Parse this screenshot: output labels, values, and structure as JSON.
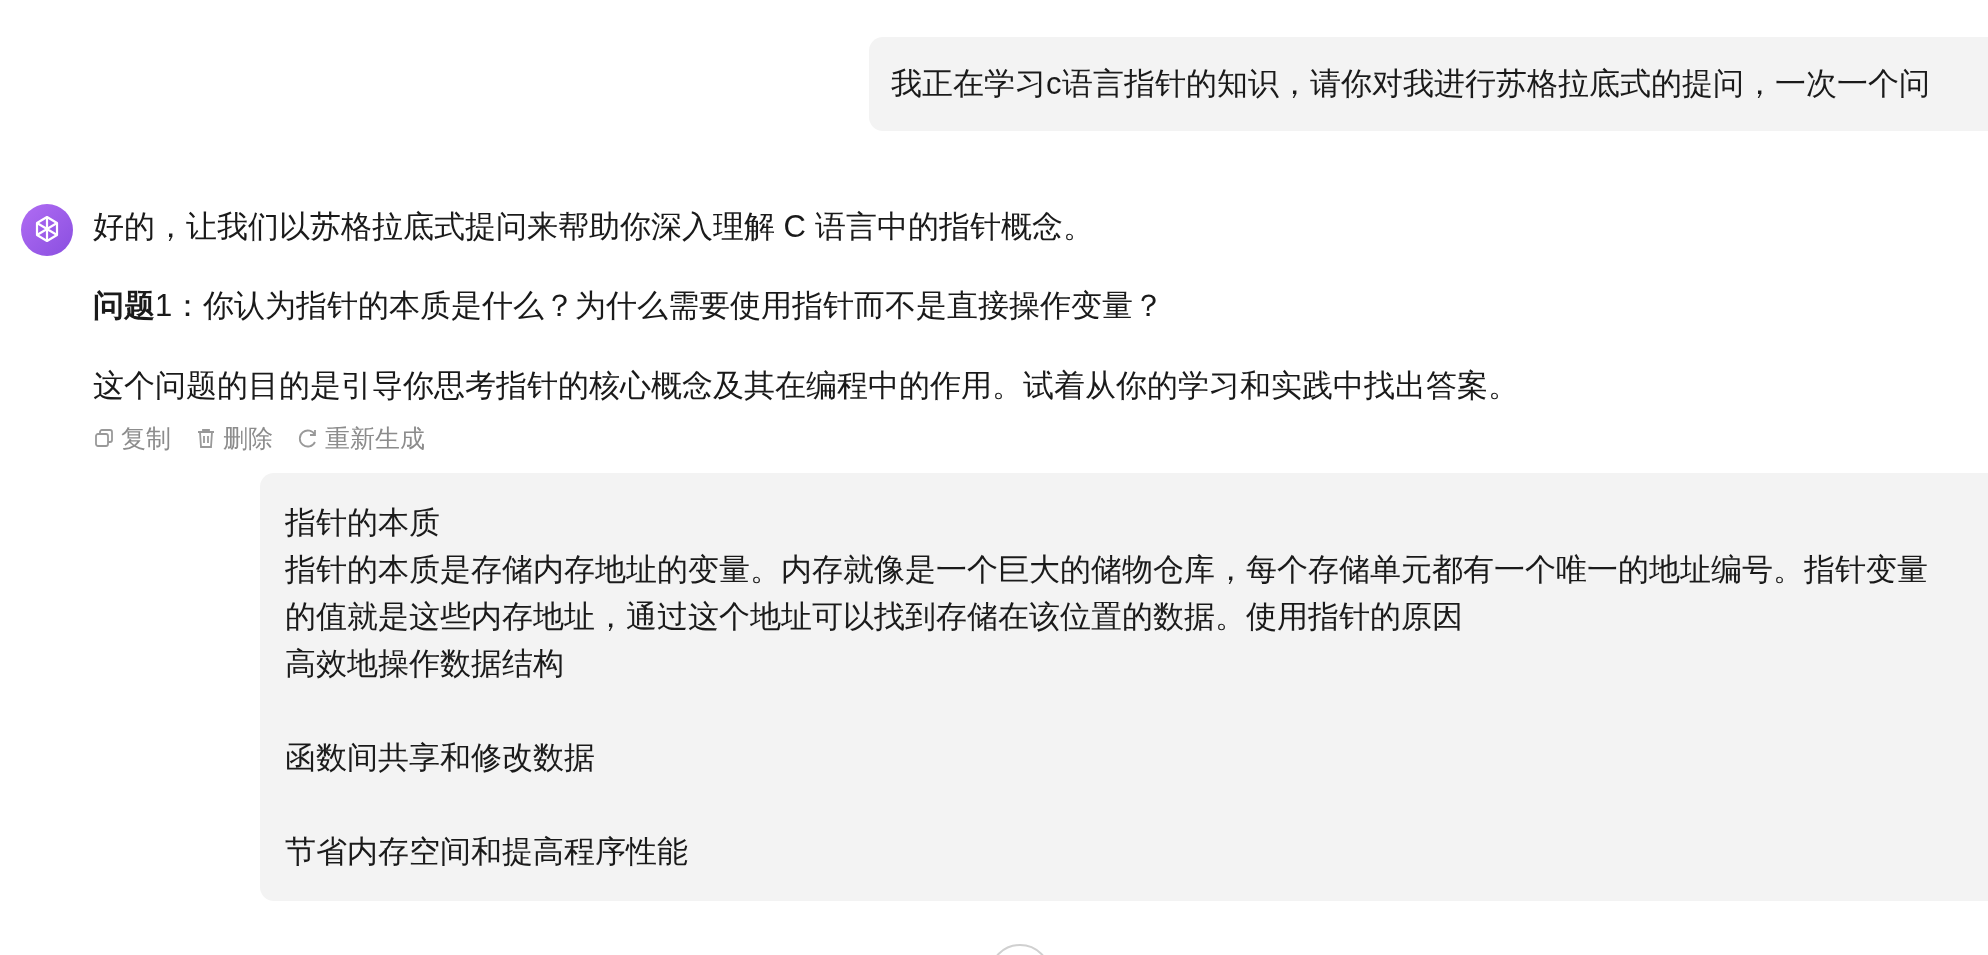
{
  "user_message": {
    "text": "我正在学习c语言指针的知识，请你对我进行苏格拉底式的提问，一次一个问"
  },
  "assistant_message": {
    "paragraphs": [
      {
        "text": "好的，让我们以苏格拉底式提问来帮助你深入理解 C 语言中的指针概念。"
      },
      {
        "text": "**问题**1：你认为指针的本质是什么？为什么需要使用指针而不是直接操作变量？"
      },
      {
        "text": "这个问题的目的是引导你思考指针的核心概念及其在编程中的作用。试着从你的学习和实践中找出答案。"
      }
    ],
    "actions": [
      {
        "kind": "copy",
        "label": "复制"
      },
      {
        "kind": "delete",
        "label": "删除"
      },
      {
        "kind": "regenerate",
        "label": "重新生成"
      }
    ]
  },
  "user_reply": {
    "blocks": [
      {
        "lines": [
          "指针的本质",
          "指针的本质是存储内存地址的变量。内存就像是一个巨大的储物仓库，每个存储单元都有一个唯一的地址编号。指针变量的值就是这些内存地址，通过这个地址可以找到存储在该位置的数据。使用指针的原因",
          "高效地操作数据结构"
        ]
      },
      {
        "lines": [
          "函数间共享和修改数据"
        ]
      },
      {
        "lines": [
          "节省内存空间和提高程序性能"
        ]
      }
    ]
  }
}
